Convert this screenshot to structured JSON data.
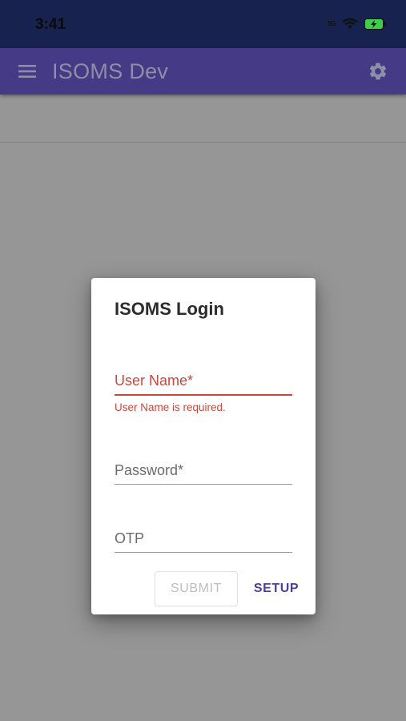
{
  "status_bar": {
    "time": "3:41",
    "network_label": "5G"
  },
  "app_bar": {
    "title": "ISOMS Dev",
    "menu_icon": "hamburger-menu-icon",
    "settings_icon": "gear-icon"
  },
  "dialog": {
    "title": "ISOMS Login",
    "username": {
      "placeholder": "User Name*",
      "value": "",
      "error": "User Name is required."
    },
    "password": {
      "placeholder": "Password*",
      "value": ""
    },
    "otp": {
      "placeholder": "OTP",
      "value": ""
    },
    "submit_label": "SUBMIT",
    "setup_label": "SETUP"
  },
  "colors": {
    "status_bar": "#17224f",
    "app_bar": "#453a86",
    "error": "#c8483c",
    "accent": "#4b3f9a",
    "battery": "#3ecf4a"
  }
}
